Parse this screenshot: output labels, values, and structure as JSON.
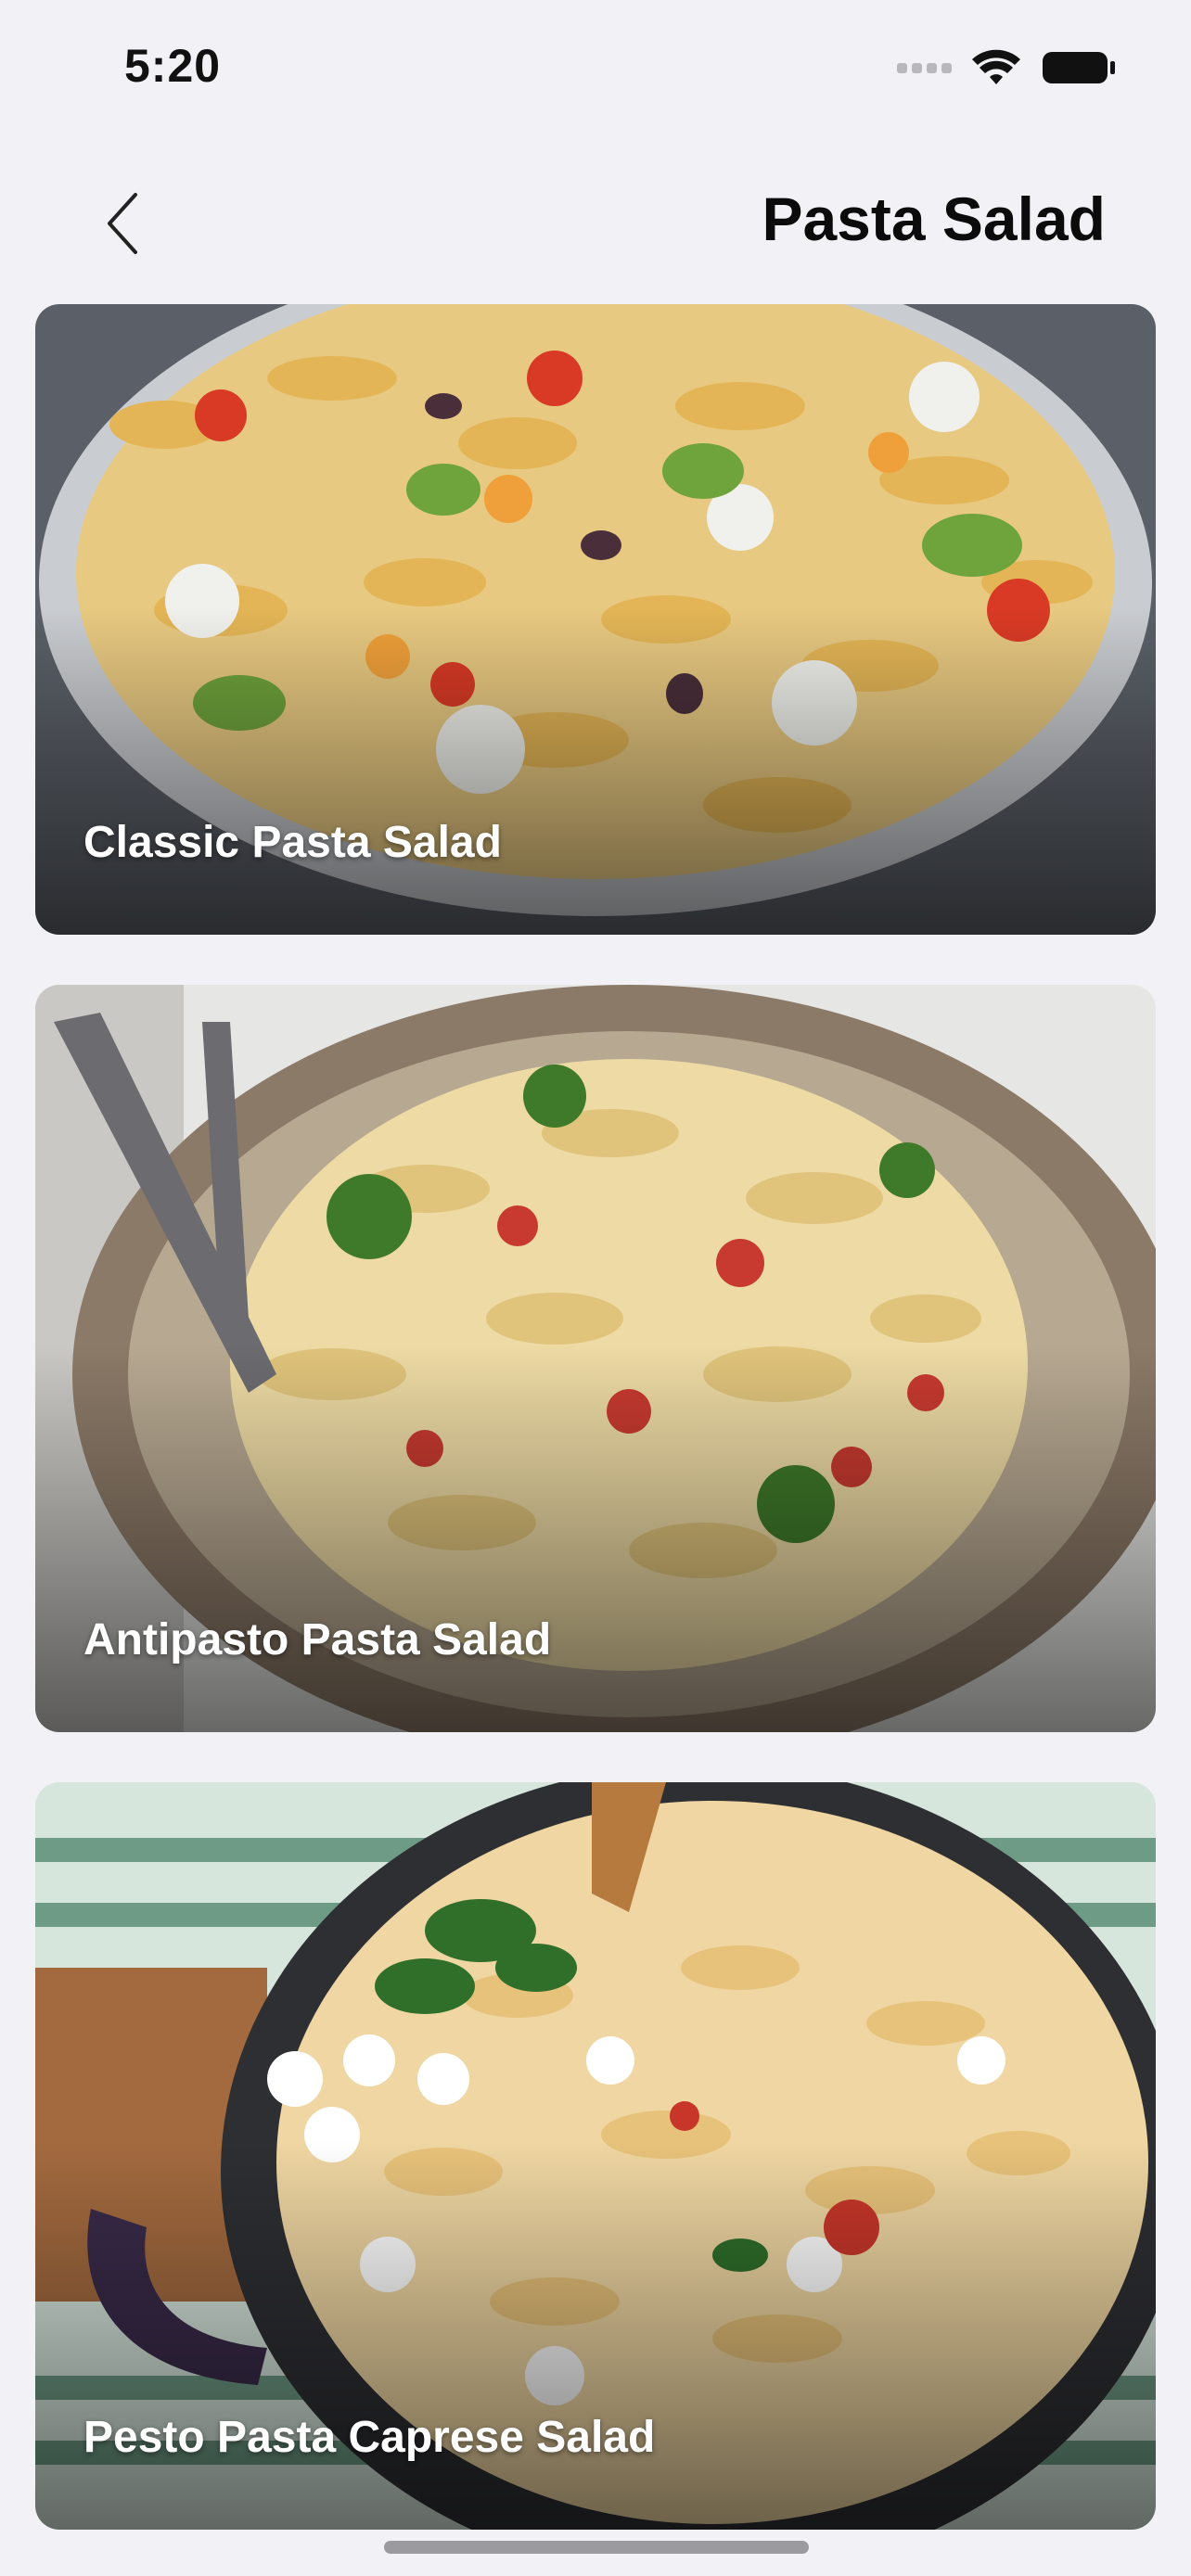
{
  "status": {
    "time": "5:20",
    "icons": [
      "signal-icon",
      "wifi-icon",
      "battery-icon"
    ]
  },
  "nav": {
    "back_icon": "chevron-left-icon",
    "title": "Pasta Salad"
  },
  "recipes": [
    {
      "title": "Classic Pasta Salad"
    },
    {
      "title": "Antipasto Pasta Salad"
    },
    {
      "title": "Pesto Pasta Caprese Salad"
    }
  ],
  "colors": {
    "background": "#f2f2f6",
    "title_text": "#0b0b0b",
    "card_text": "#ffffff"
  }
}
